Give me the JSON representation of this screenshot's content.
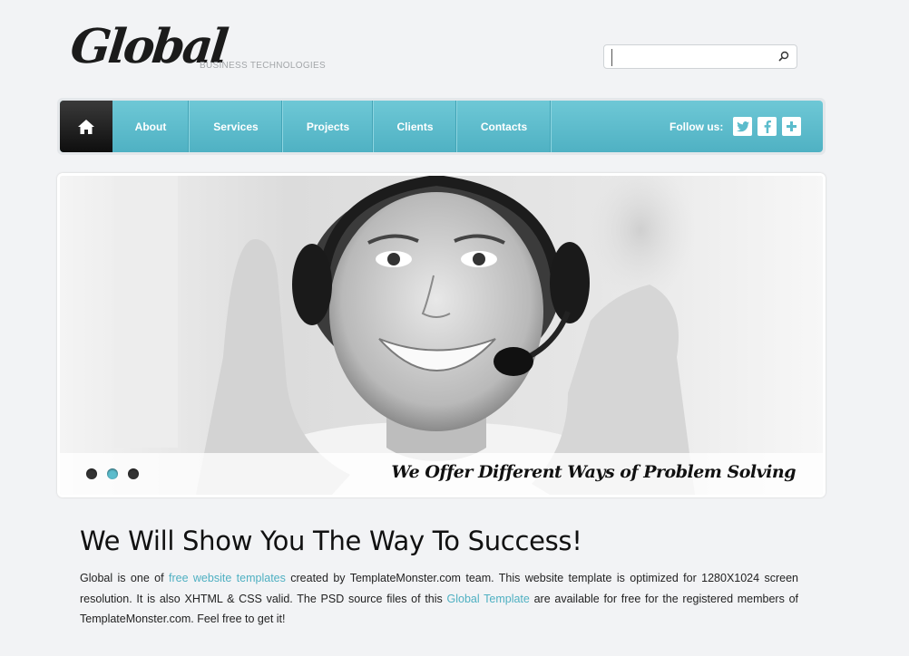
{
  "header": {
    "logo_text": "Global",
    "tagline": "BUSINESS TECHNOLOGIES",
    "search": {
      "value": "",
      "placeholder": ""
    }
  },
  "nav": {
    "home_icon": "home-icon",
    "items": [
      {
        "label": "About"
      },
      {
        "label": "Services"
      },
      {
        "label": "Projects"
      },
      {
        "label": "Clients"
      },
      {
        "label": "Contacts"
      }
    ],
    "follow_label": "Follow us:",
    "social": [
      {
        "icon": "twitter-icon"
      },
      {
        "icon": "facebook-icon"
      },
      {
        "icon": "plus-icon"
      }
    ]
  },
  "slider": {
    "caption": "We Offer Different Ways of Problem Solving",
    "slides_count": 3,
    "active_slide": 2
  },
  "content": {
    "headline": "We Will Show You The Way To Success!",
    "p1": "Global is one of ",
    "link1": "free website templates",
    "p2": " created by TemplateMonster.com team. This website template is optimized for 1280X1024 screen resolution. It is also XHTML & CSS valid. The PSD source files of this ",
    "link2": "Global Template",
    "p3": " are available for free for the registered members of TemplateMonster.com. Feel free to get it!"
  },
  "colors": {
    "accent": "#5bbccc",
    "link": "#4fb0c2",
    "home_button": "#111111",
    "background": "#f2f3f5"
  }
}
